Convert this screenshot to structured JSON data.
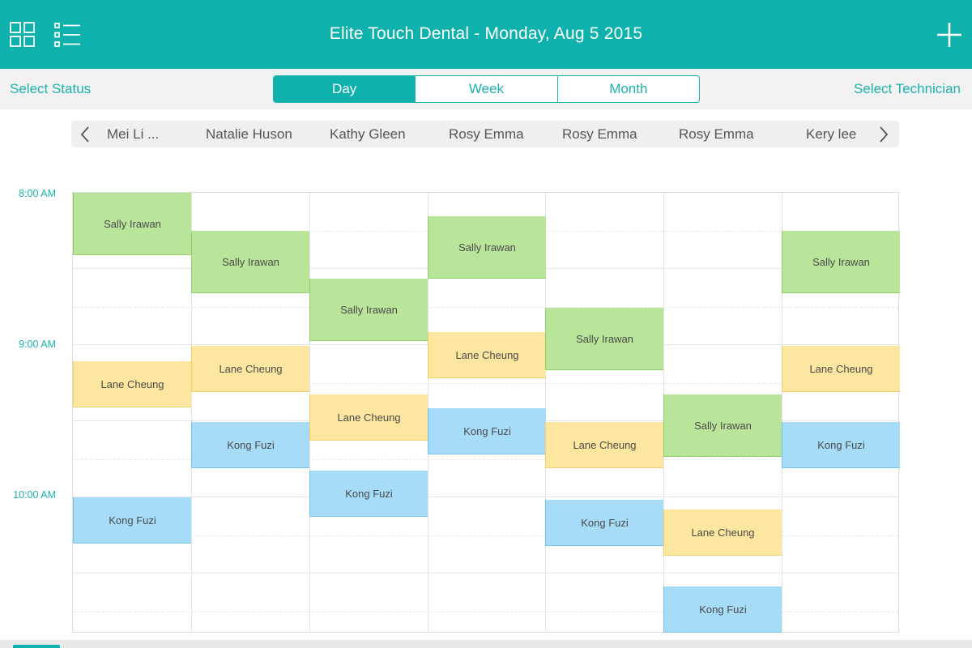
{
  "header": {
    "title": "Elite Touch Dental - Monday, Aug 5 2015",
    "icons": [
      "grid-view-icon",
      "list-view-icon",
      "plus-icon"
    ]
  },
  "subbar": {
    "select_status": "Select Status",
    "select_technician": "Select Technician",
    "view_tabs": [
      {
        "label": "Day",
        "active": true
      },
      {
        "label": "Week",
        "active": false
      },
      {
        "label": "Month",
        "active": false
      }
    ]
  },
  "technicians": [
    "Mei Li ...",
    "Natalie Huson",
    "Kathy Gleen",
    "Rosy Emma",
    "Rosy Emma",
    "Rosy Emma",
    "Kery lee"
  ],
  "times": [
    "8:00 AM",
    "9:00 AM",
    "10:00 AM"
  ],
  "colors": {
    "accent": "#0fb1ad",
    "appointment_green": "#b9e59a",
    "appointment_yellow": "#fde69f",
    "appointment_blue": "#a6dcf8"
  },
  "appointments": [
    {
      "col": 0,
      "name": "Sally Irawan",
      "color": "green"
    },
    {
      "col": 0,
      "name": "Lane Cheung",
      "color": "yellow"
    },
    {
      "col": 0,
      "name": "Kong Fuzi",
      "color": "blue"
    },
    {
      "col": 1,
      "name": "Sally Irawan",
      "color": "green"
    },
    {
      "col": 1,
      "name": "Lane Cheung",
      "color": "yellow"
    },
    {
      "col": 1,
      "name": "Kong Fuzi",
      "color": "blue"
    },
    {
      "col": 2,
      "name": "Sally Irawan",
      "color": "green"
    },
    {
      "col": 2,
      "name": "Lane Cheung",
      "color": "yellow"
    },
    {
      "col": 2,
      "name": "Kong Fuzi",
      "color": "blue"
    },
    {
      "col": 3,
      "name": "Sally Irawan",
      "color": "green"
    },
    {
      "col": 3,
      "name": "Lane Cheung",
      "color": "yellow"
    },
    {
      "col": 3,
      "name": "Kong Fuzi",
      "color": "blue"
    },
    {
      "col": 4,
      "name": "Sally Irawan",
      "color": "green"
    },
    {
      "col": 4,
      "name": "Lane Cheung",
      "color": "yellow"
    },
    {
      "col": 4,
      "name": "Kong Fuzi",
      "color": "blue"
    },
    {
      "col": 5,
      "name": "Sally Irawan",
      "color": "green"
    },
    {
      "col": 5,
      "name": "Lane Cheung",
      "color": "yellow"
    },
    {
      "col": 5,
      "name": "Kong Fuzi",
      "color": "blue"
    },
    {
      "col": 6,
      "name": "Sally Irawan",
      "color": "green"
    },
    {
      "col": 6,
      "name": "Lane Cheung",
      "color": "yellow"
    },
    {
      "col": 6,
      "name": "Kong Fuzi",
      "color": "blue"
    }
  ]
}
